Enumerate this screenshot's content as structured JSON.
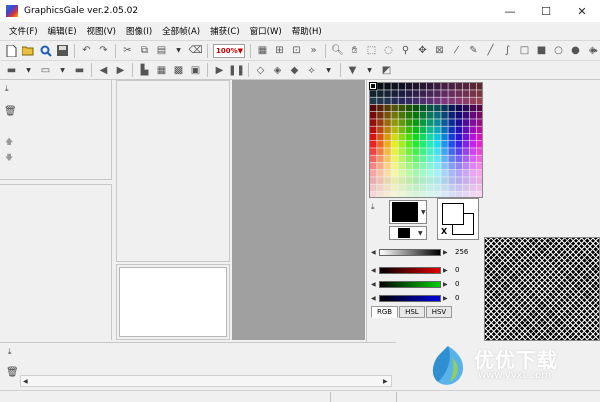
{
  "window": {
    "title": "GraphicsGale ver.2.05.02",
    "minimize": "—",
    "maximize": "☐",
    "close": "✕"
  },
  "menu": [
    "文件(F)",
    "编辑(E)",
    "视图(V)",
    "图像(I)",
    "全部帧(A)",
    "捕获(C)",
    "窗口(W)",
    "帮助(H)"
  ],
  "toolbar1": {
    "zoom": "100%",
    "more": "»",
    "more2": "»"
  },
  "color_panel": {
    "alpha_value": "256",
    "red_value": "0",
    "green_value": "0",
    "blue_value": "0",
    "tabs": [
      "RGB",
      "HSL",
      "HSV"
    ],
    "x_label": "X"
  },
  "watermark": {
    "title": "优优下载",
    "url": "www.yyxt.com"
  }
}
